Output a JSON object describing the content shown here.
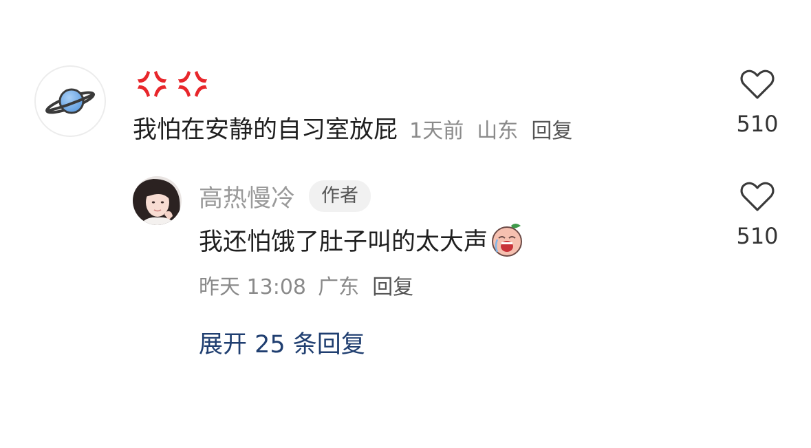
{
  "comment": {
    "avatar_icon": "planet-icon",
    "emojis": [
      "anger-symbol-icon",
      "anger-symbol-icon"
    ],
    "text": "我怕在安静的自习室放屁",
    "time": "1天前",
    "location": "山东",
    "reply_label": "回复",
    "like_icon": "heart-outline-icon",
    "likes": "510"
  },
  "reply": {
    "avatar_icon": "user-photo-avatar",
    "author": "高热慢冷",
    "author_badge": "作者",
    "text": "我还怕饿了肚子叫的太大声",
    "trailing_emoji": "crying-peach-sticker-icon",
    "time": "昨天 13:08",
    "location": "广东",
    "reply_label": "回复",
    "like_icon": "heart-outline-icon",
    "likes": "510"
  },
  "expand": {
    "label": "展开 25 条回复"
  },
  "colors": {
    "text_primary": "#1f1f1f",
    "text_secondary": "#8a8a8a",
    "link": "#1f3e70",
    "badge_bg": "#f1f1f1",
    "anger_red": "#e8262b"
  }
}
